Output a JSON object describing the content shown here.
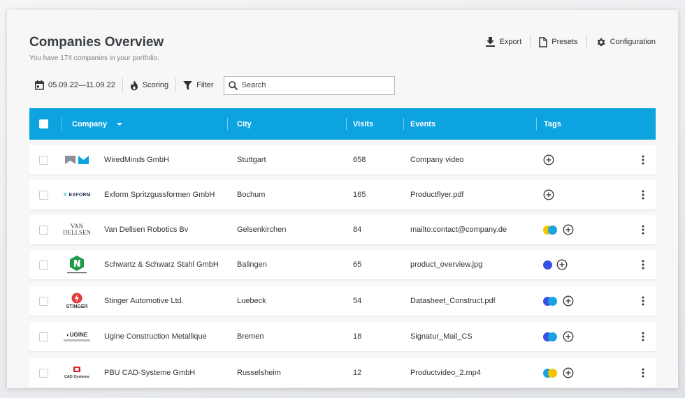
{
  "header": {
    "title": "Companies Overview",
    "subtitle": "You have 174 companies in your portfolio."
  },
  "top_actions": {
    "export_label": "Export",
    "presets_label": "Presets",
    "configuration_label": "Configuration"
  },
  "toolbar": {
    "date_range": "05.09.22—11.09.22",
    "scoring_label": "Scoring",
    "filter_label": "Filter",
    "search_placeholder": "Search"
  },
  "table": {
    "columns": {
      "company": "Company",
      "city": "City",
      "visits": "Visits",
      "events": "Events",
      "tags": "Tags"
    },
    "rows": [
      {
        "company": "WiredMinds GmbH",
        "city": "Stuttgart",
        "visits": "658",
        "event": "Company video",
        "logo": "wiredminds-logo",
        "tags": []
      },
      {
        "company": "Exform Spritzgussformen GmbH",
        "city": "Bochum",
        "visits": "165",
        "event": "Productflyer.pdf",
        "logo": "exform-logo",
        "logo_text": "EXFORM",
        "tags": []
      },
      {
        "company": "Van Dellsen Robotics Bv",
        "city": "Gelsenkirchen",
        "visits": "84",
        "event": "mailto:contact@company.de",
        "logo": "van-dellsen-logo",
        "logo_text": "VAN DELLSEN",
        "tags": [
          "#f5c400",
          "#1aa3e0"
        ]
      },
      {
        "company": "Schwartz & Schwarz Stahl GmbH",
        "city": "Balingen",
        "visits": "65",
        "event": "product_overview.jpg",
        "logo": "schwartz-logo",
        "tags": [
          "#3551e6"
        ]
      },
      {
        "company": "Stinger Automotive Ltd.",
        "city": "Luebeck",
        "visits": "54",
        "event": "Datasheet_Construct.pdf",
        "logo": "stinger-logo",
        "logo_text": "STINGER",
        "tags": [
          "#3551e6",
          "#1aa3e0"
        ]
      },
      {
        "company": "Ugine Construction Metallique",
        "city": "Bremen",
        "visits": "18",
        "event": "Signatur_Mail_CS",
        "logo": "ugine-logo",
        "logo_text": "UGINE",
        "tags": [
          "#3551e6",
          "#1aa3e0"
        ]
      },
      {
        "company": "PBU CAD-Systeme GmbH",
        "city": "Russelsheim",
        "visits": "12",
        "event": "Productvideo_2.mp4",
        "logo": "pbu-logo",
        "logo_text": "CAD Systeme",
        "tags": [
          "#1aa3e0",
          "#f5c400"
        ]
      }
    ]
  },
  "colors": {
    "header_blue": "#0ca3e0",
    "tag_blue": "#3551e6",
    "tag_cyan": "#1aa3e0",
    "tag_yellow": "#f5c400"
  }
}
